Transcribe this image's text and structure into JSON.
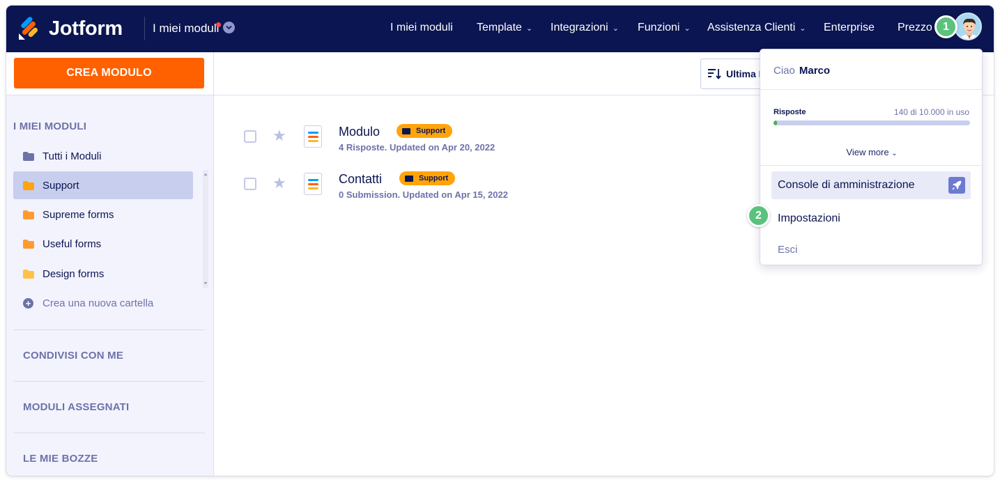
{
  "header": {
    "brand": "Jotform",
    "section_title": "I miei moduli",
    "nav": [
      {
        "label": "I miei moduli",
        "caret": ""
      },
      {
        "label": "Template",
        "caret": "⌄"
      },
      {
        "label": "Integrazioni",
        "caret": "⌄"
      },
      {
        "label": "Funzioni",
        "caret": "⌄"
      },
      {
        "label": "Assistenza Clienti",
        "caret": "⌄"
      },
      {
        "label": "Enterprise",
        "caret": ""
      },
      {
        "label": "Prezzo",
        "caret": ""
      }
    ],
    "step1": "1"
  },
  "sidebar": {
    "create_label": "CREA MODULO",
    "section_title": "I MIEI MODULI",
    "items": [
      {
        "label": "Tutti i Moduli",
        "color": "#6c73a8"
      },
      {
        "label": "Support",
        "color": "#ffa40b"
      },
      {
        "label": "Supreme forms",
        "color": "#ff9b31"
      },
      {
        "label": "Useful forms",
        "color": "#ff9b31"
      },
      {
        "label": "Design forms",
        "color": "#ffc247"
      }
    ],
    "new_folder": "Crea una nuova cartella",
    "sections": [
      "CONDIVISI CON ME",
      "MODULI ASSEGNATI",
      "LE MIE BOZZE"
    ]
  },
  "main": {
    "sort_label": "Ultima I",
    "forms": [
      {
        "title": "Modulo",
        "tag": "Support",
        "meta": "4 Risposte. Updated on Apr 20, 2022"
      },
      {
        "title": "Contatti",
        "tag": "Support",
        "meta": "0 Submission. Updated on Apr 15, 2022"
      }
    ]
  },
  "dropdown": {
    "greeting": "Ciao",
    "user": "Marco",
    "usage_label": "Risposte",
    "usage_value": "140 di 10.000 in uso",
    "usage_fraction": 0.014,
    "view_more": "View more",
    "admin_console": "Console di amministrazione",
    "settings": "Impostazioni",
    "logout": "Esci",
    "step2": "2"
  },
  "colors": {
    "navy": "#0a1551",
    "orange": "#ff6100",
    "tag": "#ffa40b",
    "badge": "#5bc27d"
  }
}
